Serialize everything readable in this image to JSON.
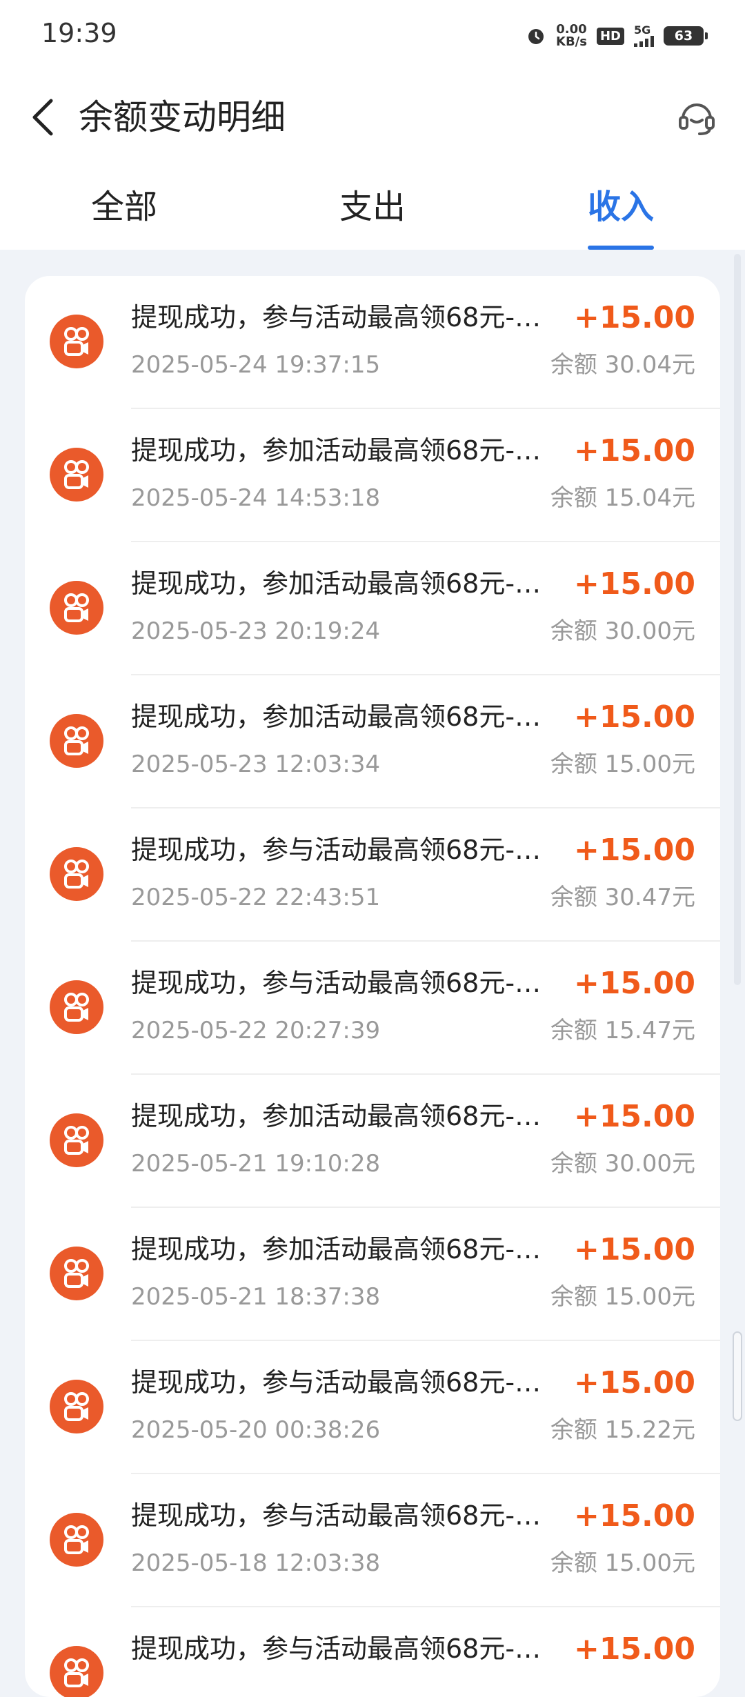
{
  "status_bar": {
    "time": "19:39",
    "speed_value": "0.00",
    "speed_unit": "KB/s",
    "hd": "HD",
    "network": "5G",
    "battery": "63"
  },
  "header": {
    "title": "余额变动明细"
  },
  "tabs": [
    {
      "label": "全部",
      "active": false
    },
    {
      "label": "支出",
      "active": false
    },
    {
      "label": "收入",
      "active": true
    }
  ],
  "colors": {
    "accent": "#2a74e6",
    "amount": "#f05a1a",
    "icon_bg": "#ea5a2b"
  },
  "icons": {
    "back": "chevron-left-icon",
    "service": "headset-icon",
    "row": "kuaishou-logo-icon"
  },
  "transactions": [
    {
      "title": "提现成功，参与活动最高领68元-…",
      "amount": "+15.00",
      "time": "2025-05-24 19:37:15",
      "balance": "余额 30.04元"
    },
    {
      "title": "提现成功，参加活动最高领68元-…",
      "amount": "+15.00",
      "time": "2025-05-24 14:53:18",
      "balance": "余额 15.04元"
    },
    {
      "title": "提现成功，参加活动最高领68元-…",
      "amount": "+15.00",
      "time": "2025-05-23 20:19:24",
      "balance": "余额 30.00元"
    },
    {
      "title": "提现成功，参加活动最高领68元-…",
      "amount": "+15.00",
      "time": "2025-05-23 12:03:34",
      "balance": "余额 15.00元"
    },
    {
      "title": "提现成功，参与活动最高领68元-…",
      "amount": "+15.00",
      "time": "2025-05-22 22:43:51",
      "balance": "余额 30.47元"
    },
    {
      "title": "提现成功，参与活动最高领68元-…",
      "amount": "+15.00",
      "time": "2025-05-22 20:27:39",
      "balance": "余额 15.47元"
    },
    {
      "title": "提现成功，参加活动最高领68元-…",
      "amount": "+15.00",
      "time": "2025-05-21 19:10:28",
      "balance": "余额 30.00元"
    },
    {
      "title": "提现成功，参加活动最高领68元-…",
      "amount": "+15.00",
      "time": "2025-05-21 18:37:38",
      "balance": "余额 15.00元"
    },
    {
      "title": "提现成功，参与活动最高领68元-…",
      "amount": "+15.00",
      "time": "2025-05-20 00:38:26",
      "balance": "余额 15.22元"
    },
    {
      "title": "提现成功，参与活动最高领68元-…",
      "amount": "+15.00",
      "time": "2025-05-18 12:03:38",
      "balance": "余额 15.00元"
    },
    {
      "title": "提现成功，参与活动最高领68元-…",
      "amount": "+15.00",
      "time": "",
      "balance": ""
    }
  ]
}
